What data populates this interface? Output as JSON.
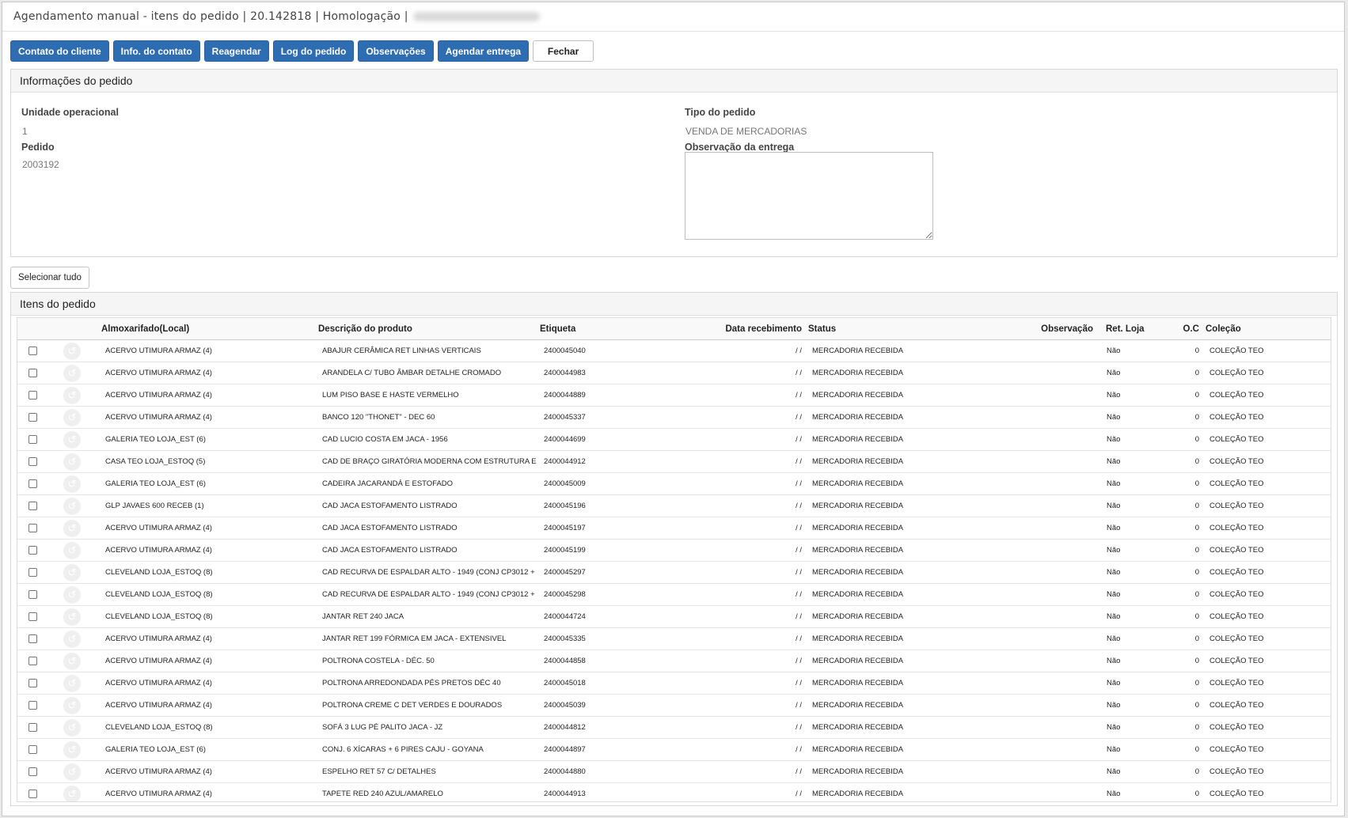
{
  "window": {
    "title": "Agendamento manual - itens do pedido | 20.142818 | Homologação |"
  },
  "toolbar": {
    "buttons": [
      {
        "label": "Contato do cliente"
      },
      {
        "label": "Info. do contato"
      },
      {
        "label": "Reagendar"
      },
      {
        "label": "Log do pedido"
      },
      {
        "label": "Observações"
      },
      {
        "label": "Agendar entrega"
      },
      {
        "label": "Fechar"
      }
    ]
  },
  "order_info": {
    "heading": "Informações do pedido",
    "unidade_label": "Unidade operacional",
    "unidade_value": "1",
    "pedido_label": "Pedido",
    "pedido_value": "2003192",
    "tipo_label": "Tipo do pedido",
    "tipo_value": "VENDA DE MERCADORIAS",
    "obs_label": "Observação da entrega",
    "obs_value": ""
  },
  "select_all_label": "Selecionar tudo",
  "items": {
    "heading": "Itens do pedido",
    "columns": [
      "Almoxarifado(Local)",
      "Descrição do produto",
      "Etiqueta",
      "Data recebimento",
      "Status",
      "Observação",
      "Ret. Loja",
      "O.C",
      "Coleção"
    ],
    "rows": [
      {
        "local": "ACERVO UTIMURA ARMAZ (4)",
        "descricao": "ABAJUR CERÂMICA RET LINHAS VERTICAIS",
        "etiqueta": "2400045040",
        "data": "/ /",
        "status": "MERCADORIA RECEBIDA",
        "obs": "",
        "ret": "Não",
        "oc": "0",
        "colecao": "COLEÇÃO TEO"
      },
      {
        "local": "ACERVO UTIMURA ARMAZ (4)",
        "descricao": "ARANDELA C/ TUBO ÂMBAR DETALHE CROMADO",
        "etiqueta": "2400044983",
        "data": "/ /",
        "status": "MERCADORIA RECEBIDA",
        "obs": "",
        "ret": "Não",
        "oc": "0",
        "colecao": "COLEÇÃO TEO"
      },
      {
        "local": "ACERVO UTIMURA ARMAZ (4)",
        "descricao": "LUM PISO BASE E HASTE VERMELHO",
        "etiqueta": "2400044889",
        "data": "/ /",
        "status": "MERCADORIA RECEBIDA",
        "obs": "",
        "ret": "Não",
        "oc": "0",
        "colecao": "COLEÇÃO TEO"
      },
      {
        "local": "ACERVO UTIMURA ARMAZ (4)",
        "descricao": "BANCO 120 \"THONET\" - DEC 60",
        "etiqueta": "2400045337",
        "data": "/ /",
        "status": "MERCADORIA RECEBIDA",
        "obs": "",
        "ret": "Não",
        "oc": "0",
        "colecao": "COLEÇÃO TEO"
      },
      {
        "local": "GALERIA TEO LOJA_EST (6)",
        "descricao": "CAD LUCIO COSTA EM JACA - 1956",
        "etiqueta": "2400044699",
        "data": "/ /",
        "status": "MERCADORIA RECEBIDA",
        "obs": "",
        "ret": "Não",
        "oc": "0",
        "colecao": "COLEÇÃO TEO"
      },
      {
        "local": "CASA TEO LOJA_ESTOQ (5)",
        "descricao": "CAD DE BRAÇO GIRATÓRIA MODERNA COM ESTRUTURA EM FE",
        "etiqueta": "2400044912",
        "data": "/ /",
        "status": "MERCADORIA RECEBIDA",
        "obs": "",
        "ret": "Não",
        "oc": "0",
        "colecao": "COLEÇÃO TEO"
      },
      {
        "local": "GALERIA TEO LOJA_EST (6)",
        "descricao": "CADEIRA JACARANDÁ E ESTOFADO",
        "etiqueta": "2400045009",
        "data": "/ /",
        "status": "MERCADORIA RECEBIDA",
        "obs": "",
        "ret": "Não",
        "oc": "0",
        "colecao": "COLEÇÃO TEO"
      },
      {
        "local": "GLP JAVAES 600 RECEB (1)",
        "descricao": "CAD JACA ESTOFAMENTO LISTRADO",
        "etiqueta": "2400045196",
        "data": "/ /",
        "status": "MERCADORIA RECEBIDA",
        "obs": "",
        "ret": "Não",
        "oc": "0",
        "colecao": "COLEÇÃO TEO"
      },
      {
        "local": "ACERVO UTIMURA ARMAZ (4)",
        "descricao": "CAD JACA ESTOFAMENTO LISTRADO",
        "etiqueta": "2400045197",
        "data": "/ /",
        "status": "MERCADORIA RECEBIDA",
        "obs": "",
        "ret": "Não",
        "oc": "0",
        "colecao": "COLEÇÃO TEO"
      },
      {
        "local": "ACERVO UTIMURA ARMAZ (4)",
        "descricao": "CAD JACA ESTOFAMENTO LISTRADO",
        "etiqueta": "2400045199",
        "data": "/ /",
        "status": "MERCADORIA RECEBIDA",
        "obs": "",
        "ret": "Não",
        "oc": "0",
        "colecao": "COLEÇÃO TEO"
      },
      {
        "local": "CLEVELAND LOJA_ESTOQ (8)",
        "descricao": "CAD RECURVA DE ESPALDAR ALTO - 1949 (CONJ CP3012 +",
        "etiqueta": "2400045297",
        "data": "/ /",
        "status": "MERCADORIA RECEBIDA",
        "obs": "",
        "ret": "Não",
        "oc": "0",
        "colecao": "COLEÇÃO TEO"
      },
      {
        "local": "CLEVELAND LOJA_ESTOQ (8)",
        "descricao": "CAD RECURVA DE ESPALDAR ALTO - 1949 (CONJ CP3012 +",
        "etiqueta": "2400045298",
        "data": "/ /",
        "status": "MERCADORIA RECEBIDA",
        "obs": "",
        "ret": "Não",
        "oc": "0",
        "colecao": "COLEÇÃO TEO"
      },
      {
        "local": "CLEVELAND LOJA_ESTOQ (8)",
        "descricao": "JANTAR RET 240 JACA",
        "etiqueta": "2400044724",
        "data": "/ /",
        "status": "MERCADORIA RECEBIDA",
        "obs": "",
        "ret": "Não",
        "oc": "0",
        "colecao": "COLEÇÃO TEO"
      },
      {
        "local": "ACERVO UTIMURA ARMAZ (4)",
        "descricao": "JANTAR RET 199 FÓRMICA EM JACA - EXTENSIVEL",
        "etiqueta": "2400045335",
        "data": "/ /",
        "status": "MERCADORIA RECEBIDA",
        "obs": "",
        "ret": "Não",
        "oc": "0",
        "colecao": "COLEÇÃO TEO"
      },
      {
        "local": "ACERVO UTIMURA ARMAZ (4)",
        "descricao": "POLTRONA COSTELA - DÉC. 50",
        "etiqueta": "2400044858",
        "data": "/ /",
        "status": "MERCADORIA RECEBIDA",
        "obs": "",
        "ret": "Não",
        "oc": "0",
        "colecao": "COLEÇÃO TEO"
      },
      {
        "local": "ACERVO UTIMURA ARMAZ (4)",
        "descricao": "POLTRONA ARREDONDADA PÉS PRETOS DÉC 40",
        "etiqueta": "2400045018",
        "data": "/ /",
        "status": "MERCADORIA RECEBIDA",
        "obs": "",
        "ret": "Não",
        "oc": "0",
        "colecao": "COLEÇÃO TEO"
      },
      {
        "local": "ACERVO UTIMURA ARMAZ (4)",
        "descricao": "POLTRONA CREME C DET VERDES E DOURADOS",
        "etiqueta": "2400045039",
        "data": "/ /",
        "status": "MERCADORIA RECEBIDA",
        "obs": "",
        "ret": "Não",
        "oc": "0",
        "colecao": "COLEÇÃO TEO"
      },
      {
        "local": "CLEVELAND LOJA_ESTOQ (8)",
        "descricao": "SOFÁ 3 LUG PÉ PALITO JACA - JZ",
        "etiqueta": "2400044812",
        "data": "/ /",
        "status": "MERCADORIA RECEBIDA",
        "obs": "",
        "ret": "Não",
        "oc": "0",
        "colecao": "COLEÇÃO TEO"
      },
      {
        "local": "GALERIA TEO LOJA_EST (6)",
        "descricao": "CONJ. 6 XÍCARAS + 6 PIRES CAJU - GOYANA",
        "etiqueta": "2400044897",
        "data": "/ /",
        "status": "MERCADORIA RECEBIDA",
        "obs": "",
        "ret": "Não",
        "oc": "0",
        "colecao": "COLEÇÃO TEO"
      },
      {
        "local": "ACERVO UTIMURA ARMAZ (4)",
        "descricao": "ESPELHO RET 57 C/ DETALHES",
        "etiqueta": "2400044880",
        "data": "/ /",
        "status": "MERCADORIA RECEBIDA",
        "obs": "",
        "ret": "Não",
        "oc": "0",
        "colecao": "COLEÇÃO TEO"
      },
      {
        "local": "ACERVO UTIMURA ARMAZ (4)",
        "descricao": "TAPETE RED 240 AZUL/AMARELO",
        "etiqueta": "2400044913",
        "data": "/ /",
        "status": "MERCADORIA RECEBIDA",
        "obs": "",
        "ret": "Não",
        "oc": "0",
        "colecao": "COLEÇÃO TEO"
      }
    ]
  },
  "colors": {
    "primary_button": "#2f6db3",
    "panel_heading_bg": "#f5f5f5"
  },
  "icons": {
    "row_action": "history-icon"
  }
}
